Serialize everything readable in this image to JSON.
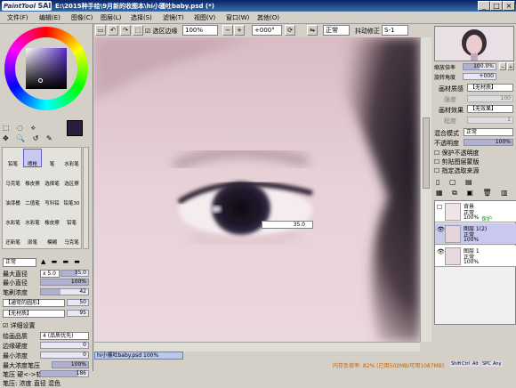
{
  "window": {
    "title": "E:\\2015种手绘\\9月新的收图本\\hi小骚吐baby.psd (*)",
    "app_logo_small": "PaintTool",
    "app_logo_big": "SAI"
  },
  "menu": [
    "文件(F)",
    "编辑(E)",
    "图像(C)",
    "图层(L)",
    "选择(S)",
    "滤镜(T)",
    "视图(V)",
    "窗口(W)",
    "其他(O)"
  ],
  "toolbar": {
    "selection_edge": "选区边缘",
    "zoom": "100%",
    "angle": "+000°",
    "blend": "正常",
    "stabilizer_label": "抖动修正",
    "stabilizer": "S-1"
  },
  "tools": [
    [
      "铅笔",
      "喷枪",
      "笔",
      "水彩笔"
    ],
    [
      "马克笔",
      "橡皮擦",
      "选择笔",
      "选区擦"
    ],
    [
      "油漆桶",
      "二值笔",
      "写科铅笔",
      "铅笔30"
    ],
    [
      "水彩笔80",
      "水彩笔10",
      "橡皮擦2",
      "铅笔"
    ],
    [
      "还新笔",
      "澍笔",
      "模糊",
      "马克笔"
    ]
  ],
  "brush": {
    "mode": "正常",
    "max_size_label": "最大直径",
    "max_size_mult": "x 5.0",
    "max_size": "35.0",
    "min_size_label": "最小直径",
    "min_size": "100%",
    "density_label": "笔刷浓度",
    "density": "42",
    "shape": "【通常的圆形】",
    "shape_val": "50",
    "texture": "【无材质】",
    "texture_val": "95",
    "detail_label": "详细设置",
    "quality_label": "绘画品质",
    "quality": "4 (品质优先)",
    "edge_label": "边缘硬度",
    "edge": "0",
    "min_density_label": "最小浓度",
    "min_density": "0",
    "max_pressure_label": "最大浓度笔压",
    "max_pressure": "100%",
    "pressure_label": "笔压 硬<->软",
    "pressure": "186",
    "footer_label": "笔压:",
    "footer_opts": "浓度  直径  混色"
  },
  "brush_tooltip": "35.0",
  "canvas_tab": {
    "name": "hi小骚吐baby.psd",
    "zoom": "100%"
  },
  "navigator": {
    "zoom_label": "缩放倍率",
    "zoom": "100.0%",
    "angle_label": "旋转角度",
    "angle": "+000"
  },
  "paper": {
    "texture_label": "画材质感",
    "texture": "【无材质】",
    "strength_label": "强度",
    "strength": "100",
    "effect_label": "画材效果",
    "effect": "【无效果】",
    "effect_strength_label": "程度",
    "effect_strength": "1"
  },
  "layer_panel": {
    "blend_label": "混合模式",
    "blend": "正常",
    "opacity_label": "不透明度",
    "opacity": "100%",
    "check1": "保护不透明度",
    "check2": "剪贴图层蒙版",
    "check3": "指定选取来源",
    "layers": [
      {
        "name": "背景",
        "mode": "正常",
        "opacity": "100%",
        "extra": "保护"
      },
      {
        "name": "图层 1(2)",
        "mode": "正常",
        "opacity": "100%",
        "extra": ""
      },
      {
        "name": "图层 1",
        "mode": "正常",
        "opacity": "100%",
        "extra": ""
      }
    ]
  },
  "status": {
    "memory": "内存负荷率: 82% (已用502MB/可用1087MB)",
    "keys": [
      "Shift",
      "Ctrl",
      "Alt",
      "SPC",
      "Any"
    ]
  },
  "colors": {
    "primary": "#2a1e3c",
    "secondary": "#ffffff",
    "accent": "#0a246a"
  }
}
